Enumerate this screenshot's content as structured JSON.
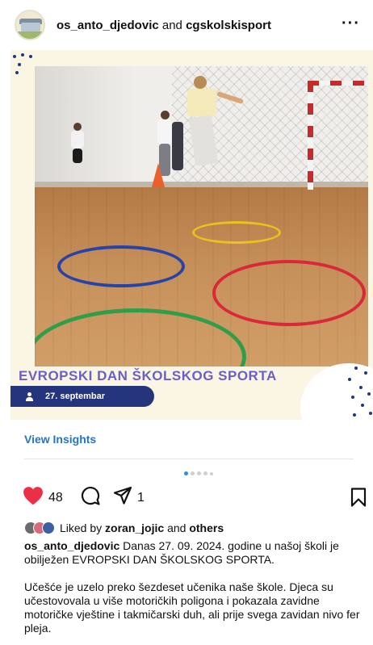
{
  "header": {
    "user1": "os_anto_djedovic",
    "conjunction": "and",
    "user2": "cgskolskisport",
    "more_icon": "more-horizontal-icon",
    "more_label": "···"
  },
  "media": {
    "banner_title": "EVROPSKI DAN ŠKOLSKOG SPORTA",
    "date_label": "27. septembar",
    "theme_colors": {
      "cream": "#fbf6e4",
      "navy": "#24357d",
      "title": "#6a5fc7"
    }
  },
  "insights": {
    "label": "View Insights",
    "color": "#2473c6"
  },
  "carousel": {
    "total_dots": 5,
    "active_index": 0
  },
  "actions": {
    "like_icon": "heart-icon",
    "like_count": "48",
    "like_color": "#ed2e47",
    "comment_icon": "comment-icon",
    "share_icon": "send-icon",
    "share_count": "1",
    "save_icon": "bookmark-icon"
  },
  "likes": {
    "prefix": "Liked by",
    "user": "zoran_jojic",
    "conjunction": "and",
    "others": "others"
  },
  "caption": {
    "user": "os_anto_djedovic",
    "line1": "Danas 27. 09. 2024. godine u našoj školi je obilježen EVROPSKI DAN ŠKOLSKOG SPORTA.",
    "paragraph2": "Učešće je uzelo preko šezdeset učenika naše škole. Djeca su učestovovala u više motoričkih poligona i pokazala zavidne motoričke vještine i takmičarski duh, ali prije svega zavidan nivo fer pleja."
  }
}
